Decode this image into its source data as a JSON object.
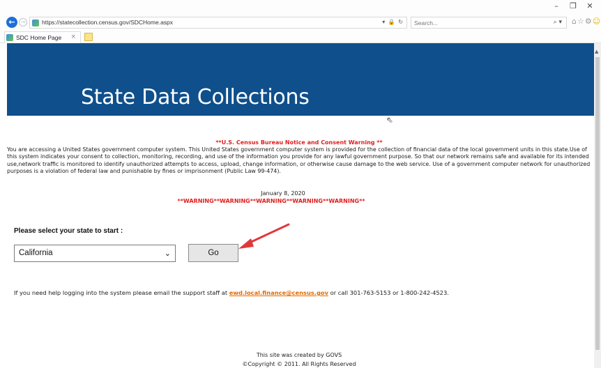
{
  "browser": {
    "url": "https://statecollection.census.gov/SDCHome.aspx",
    "search_placeholder": "Search...",
    "tab_title": "SDC Home Page",
    "tab_close": "×",
    "window_controls": {
      "minimize": "–",
      "restore": "❐",
      "close": "✕"
    },
    "addr_actions": "▾ 🔒 ↻",
    "search_icon_glyph": "⌕ ▾",
    "toolbar_icons": [
      "home-icon",
      "star-icon",
      "settings-icon",
      "smiley-icon"
    ]
  },
  "banner": {
    "title": "State Data Collections",
    "color": "#0f4f8c"
  },
  "notice": {
    "heading": "**U.S. Census Bureau Notice and Consent Warning **",
    "body": "You are accessing a United States government computer system. This United States government computer system is provided for the collection of financial data of the local government units in this state.Use of this system indicates your consent to collection, monitoring, recording, and use of the information you provide for any lawful government purpose. So that our network remains safe and available for its intended use,network traffic is monitored to identify unauthorized attempts to access, upload, change information, or otherwise cause damage to the web service. Use of a government computer network for unauthorized purposes is a violation of federal law and punishable by fines or imprisonment (Public Law 99-474).",
    "date": "January 8, 2020",
    "warning": "**WARNING**WARNING**WARNING**WARNING**WARNING**",
    "warning_color": "#e11d1d"
  },
  "state_select": {
    "label": "Please select your state to start :",
    "selected_value": "California",
    "go_label": "Go"
  },
  "help": {
    "prefix": "If you need help logging into the system please email the support staff at ",
    "email": "ewd.local.finance@census.gov",
    "suffix": " or call 301-763-5153 or 1-800-242-4523."
  },
  "footer": {
    "line1": "This site was created by GOVS",
    "line2": "©Copyright © 2011. All Rights Reserved"
  }
}
